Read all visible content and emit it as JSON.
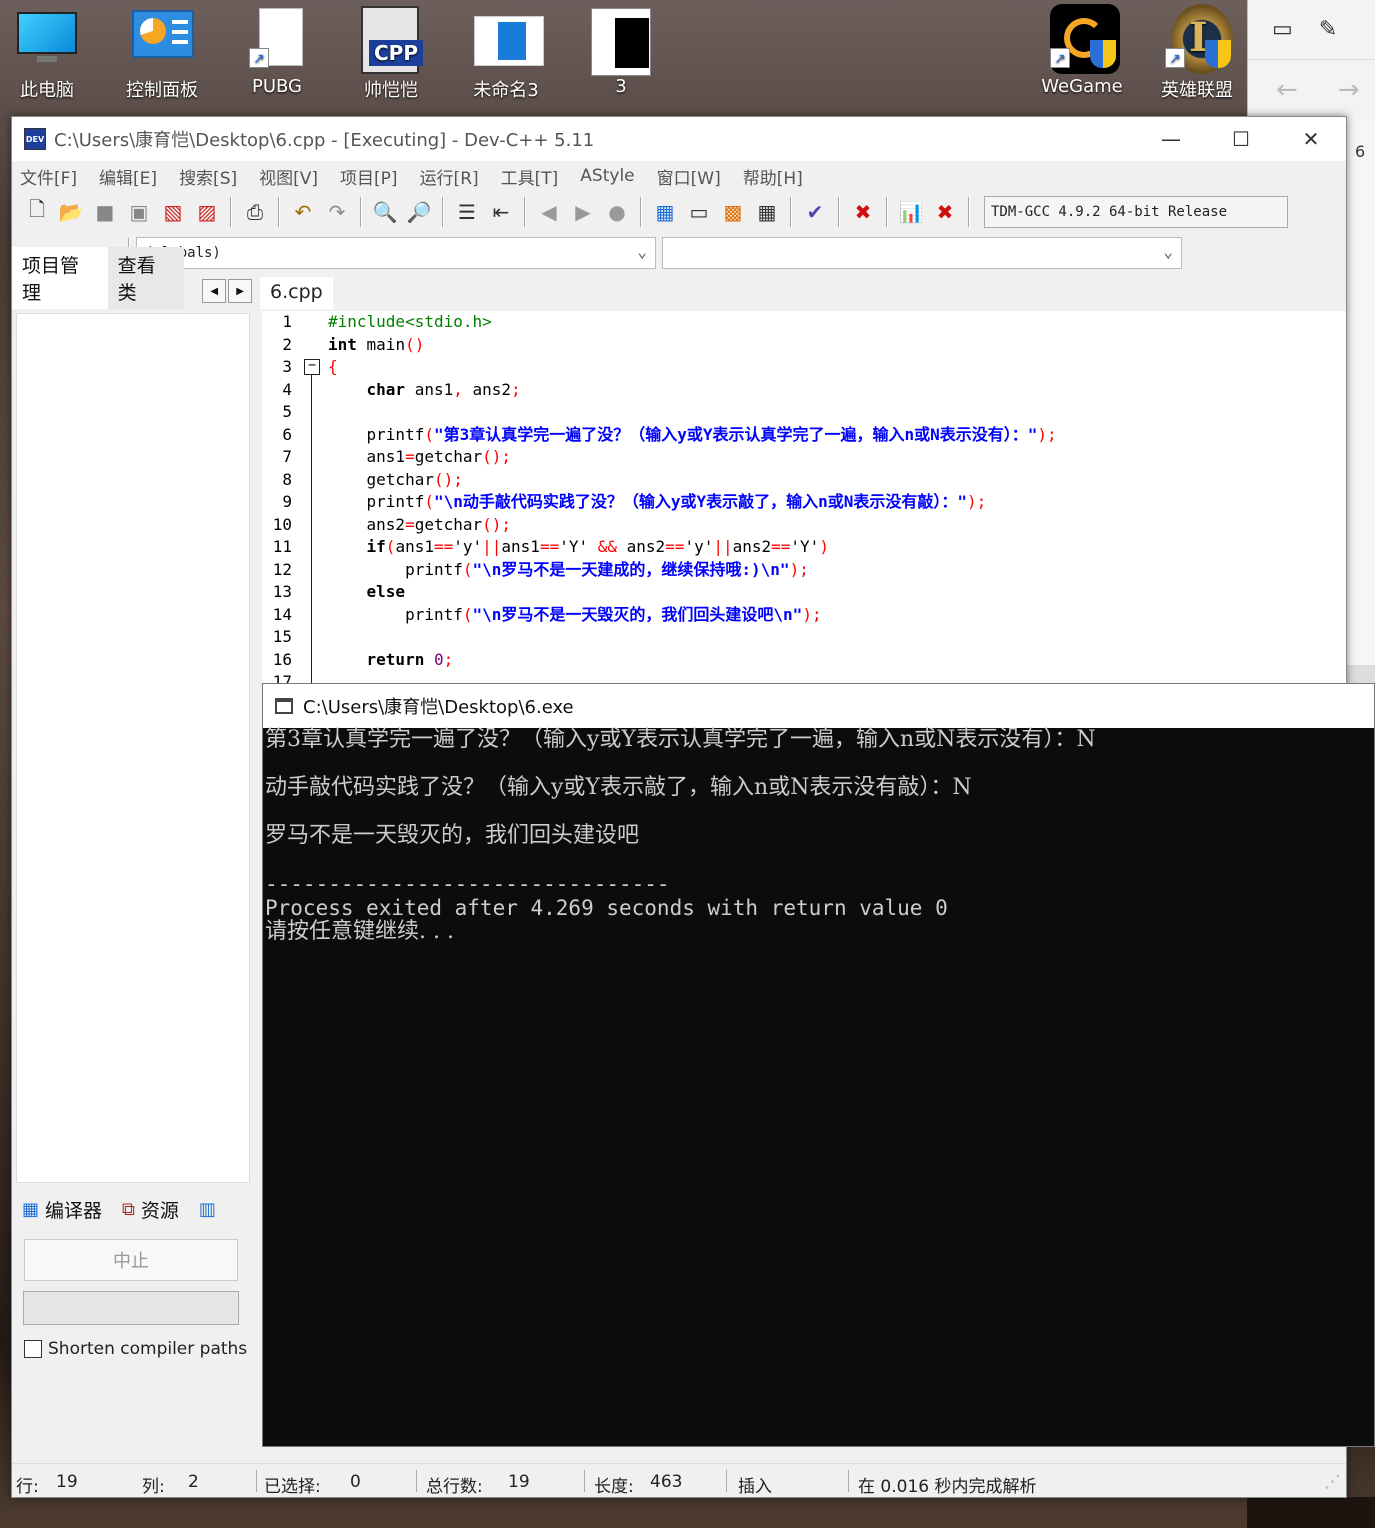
{
  "desktop": {
    "icons": [
      {
        "label": "此电脑"
      },
      {
        "label": "控制面板"
      },
      {
        "label": "PUBG"
      },
      {
        "label": "帅恺恺"
      },
      {
        "label": "未命名3"
      },
      {
        "label": "3"
      },
      {
        "label": "WeGame"
      },
      {
        "label": "英雄联盟"
      }
    ],
    "side_tab": "6"
  },
  "devcpp": {
    "title": "C:\\Users\\康育恺\\Desktop\\6.cpp - [Executing] - Dev-C++ 5.11",
    "menu": [
      "文件[F]",
      "编辑[E]",
      "搜索[S]",
      "视图[V]",
      "项目[P]",
      "运行[R]",
      "工具[T]",
      "AStyle",
      "窗口[W]",
      "帮助[H]"
    ],
    "compiler": "TDM-GCC 4.9.2 64-bit Release",
    "scope": "(globals)",
    "left_tabs": [
      "项目管理",
      "查看类"
    ],
    "editor_tab": "6.cpp",
    "line_numbers": [
      "1",
      "2",
      "3",
      "4",
      "5",
      "6",
      "7",
      "8",
      "9",
      "10",
      "11",
      "12",
      "13",
      "14",
      "15",
      "16",
      "17"
    ],
    "code": {
      "l1": "#include<stdio.h>",
      "l2_kw": "int",
      "l2_fn": " main",
      "l2_sym": "()",
      "l3": "{",
      "l4_kw": "char",
      "l4_rest": " ans1",
      "l4_sym1": ",",
      "l4_rest2": " ans2",
      "l4_sym2": ";",
      "l6_fn": "printf",
      "l6_sym1": "(",
      "l6_str": "\"第3章认真学完一遍了没？（输入y或Y表示认真学完了一遍，输入n或N表示没有）：\"",
      "l6_sym2": ");",
      "l7_fn": "ans1",
      "l7_sym1": "=",
      "l7_fn2": "getchar",
      "l7_sym2": "();",
      "l8_fn": "getchar",
      "l8_sym": "();",
      "l9_fn": "printf",
      "l9_sym1": "(",
      "l9_str": "\"\\n动手敲代码实践了没？（输入y或Y表示敲了，输入n或N表示没有敲）：\"",
      "l9_sym2": ");",
      "l10_fn": "ans2",
      "l10_sym1": "=",
      "l10_fn2": "getchar",
      "l10_sym2": "();",
      "l11": {
        "kw": "if",
        "p1": "(",
        "a": "ans1",
        "eq1": "==",
        "c1": "'y'",
        "or1": "||",
        "b": "ans1",
        "eq2": "==",
        "c2": "'Y'",
        "and": " && ",
        "c": "ans2",
        "eq3": "==",
        "c3": "'y'",
        "or2": "||",
        "d": "ans2",
        "eq4": "==",
        "c4": "'Y'",
        "p2": ")"
      },
      "l12_fn": "printf",
      "l12_sym1": "(",
      "l12_str": "\"\\n罗马不是一天建成的，继续保持哦:)\\n\"",
      "l12_sym2": ");",
      "l13_kw": "else",
      "l14_fn": "printf",
      "l14_sym1": "(",
      "l14_str": "\"\\n罗马不是一天毁灭的，我们回头建设吧\\n\"",
      "l14_sym2": ");",
      "l16_kw": "return",
      "l16_num": " 0",
      "l16_sym": ";"
    },
    "bottom_tabs": [
      "编译器",
      "资源"
    ],
    "abort_label": "中止",
    "shorten_label": "Shorten compiler paths",
    "status": {
      "line_label": "行:",
      "line": "19",
      "col_label": "列:",
      "col": "2",
      "sel_label": "已选择:",
      "sel": "0",
      "total_label": "总行数:",
      "total": "19",
      "len_label": "长度:",
      "len": "463",
      "mode": "插入",
      "parse": "在 0.016 秒内完成解析"
    }
  },
  "console": {
    "title": "C:\\Users\\康育恺\\Desktop\\6.exe",
    "line1": "第3章认真学完一遍了没？（输入y或Y表示认真学完了一遍，输入n或N表示没有）：N",
    "line2": "动手敲代码实践了没？（输入y或Y表示敲了，输入n或N表示没有敲）：N",
    "line3": "罗马不是一天毁灭的，我们回头建设吧",
    "separator": "--------------------------------",
    "process": "Process exited after 4.269 seconds with return value 0",
    "press": "请按任意键继续. . ."
  }
}
